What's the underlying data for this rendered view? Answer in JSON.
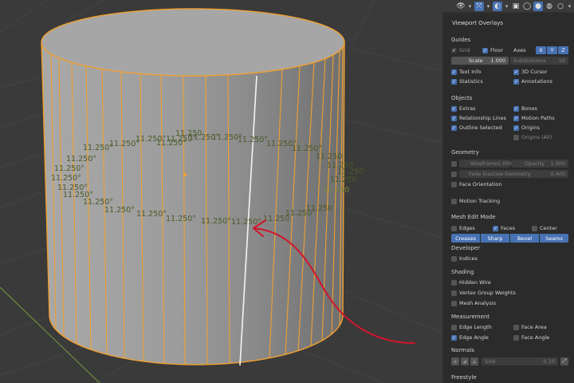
{
  "viewport": {
    "edge_angle_label": "11.250°",
    "edge_angle_label_short": "11.250",
    "background_color": "#3a3a3a",
    "cylinder_face_color": "#9a9a9a",
    "edge_color": "#f0a030",
    "selected_edge_color": "#ffffff",
    "annotation_color": "#d0152a"
  },
  "header": {
    "icons": [
      "visibility-icon",
      "gizmo-icon",
      "overlay-icon",
      "xray-icon",
      "wireframe-shading-icon",
      "solid-shading-icon",
      "material-shading-icon",
      "rendered-shading-icon"
    ]
  },
  "overlays": {
    "title": "Viewport Overlays",
    "guides": {
      "title": "Guides",
      "grid": "Grid",
      "floor": "Floor",
      "axes": "Axes",
      "axis_x": "X",
      "axis_y": "Y",
      "axis_z": "Z",
      "scale_label": "Scale",
      "scale_value": "1.000",
      "subdivisions_label": "Subdivisions",
      "subdivisions_value": "10",
      "text_info": "Text Info",
      "cursor_3d": "3D Cursor",
      "statistics": "Statistics",
      "annotations": "Annotations"
    },
    "objects": {
      "title": "Objects",
      "extras": "Extras",
      "bones": "Bones",
      "relationship_lines": "Relationship Lines",
      "motion_paths": "Motion Paths",
      "outline_selected": "Outline Selected",
      "origins": "Origins",
      "origins_all": "Origins (All)"
    },
    "geometry": {
      "title": "Geometry",
      "wireframe_label": "Wireframe",
      "wireframe_value": "1.000",
      "opacity_label": "Opacity",
      "opacity_value": "1.000",
      "fade_label": "Fade Inactive Geometry",
      "fade_value": "0.400",
      "face_orientation": "Face Orientation"
    },
    "motion_tracking": "Motion Tracking",
    "mesh_edit": {
      "title": "Mesh Edit Mode",
      "edges": "Edges",
      "faces": "Faces",
      "center": "Center",
      "creases": "Creases",
      "sharp": "Sharp",
      "bevel": "Bevel",
      "seams": "Seams"
    },
    "developer": {
      "title": "Developer",
      "indices": "Indices"
    },
    "shading": {
      "title": "Shading",
      "hidden_wire": "Hidden Wire",
      "vertex_group_weights": "Vertex Group Weights",
      "mesh_analysis": "Mesh Analysis"
    },
    "measurement": {
      "title": "Measurement",
      "edge_length": "Edge Length",
      "face_area": "Face Area",
      "edge_angle": "Edge Angle",
      "face_angle": "Face Angle"
    },
    "normals": {
      "title": "Normals",
      "size_label": "Size",
      "size_value": "0.10"
    },
    "freestyle": {
      "title": "Freestyle"
    }
  }
}
